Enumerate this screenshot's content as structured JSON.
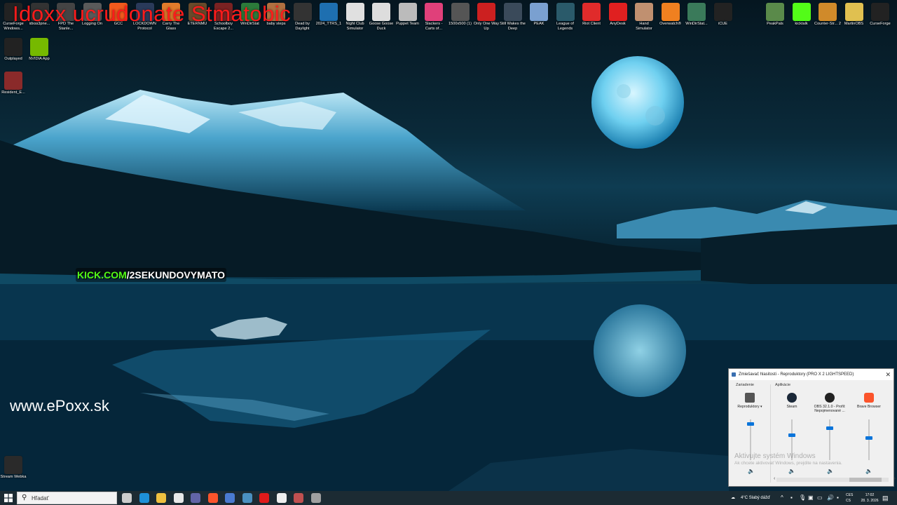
{
  "overlay": {
    "red_text": "Idoxx ucrudonate Stmatobic",
    "kick_part1": "KICK.COM",
    "kick_part2": "/2SEKUNDOVYMATO",
    "site_url": "www.ePoxx.sk"
  },
  "desktop_icons_top": [
    {
      "label": "CurseForge Windows...",
      "color": "#222222"
    },
    {
      "label": "idxss3pne...",
      "color": "#333333"
    },
    {
      "label": "FPD The Stanle...",
      "color": "#444444"
    },
    {
      "label": "Logging On",
      "color": "#5a5a5a"
    },
    {
      "label": "GCC",
      "color": "#f25a1d"
    },
    {
      "label": "LOCKDOWN Protocol",
      "color": "#2a3a5a"
    },
    {
      "label": "Carry The Glass",
      "color": "#e07b2b"
    },
    {
      "label": "ETERNMU",
      "color": "#6a4a2a"
    },
    {
      "label": "Schoolboy Escape 2...",
      "color": "#7a2222"
    },
    {
      "label": "WinDirStat",
      "color": "#2c7a3a"
    },
    {
      "label": "baby steps",
      "color": "#b07040"
    },
    {
      "label": "Dead by Daylight",
      "color": "#333333"
    },
    {
      "label": "2024_TTRS_1",
      "color": "#1e6fb0"
    },
    {
      "label": "Night Club Simulator",
      "color": "#e0e0e0"
    },
    {
      "label": "Goose Goose Duck",
      "color": "#dddddd"
    },
    {
      "label": "Puppet Team",
      "color": "#bbbbbb"
    },
    {
      "label": "Slackers - Carts of...",
      "color": "#e0407a"
    },
    {
      "label": "1500x500 (1)",
      "color": "#555555"
    },
    {
      "label": "Only One Way Up",
      "color": "#cc2020"
    },
    {
      "label": "Still Wakes the Deep",
      "color": "#3a4a5a"
    },
    {
      "label": "PEAK",
      "color": "#7aa0d0"
    },
    {
      "label": "League of Legends",
      "color": "#2a5a6a"
    },
    {
      "label": "Riot Client",
      "color": "#e02b2b"
    },
    {
      "label": "AnyDesk",
      "color": "#e02020"
    },
    {
      "label": "Hand Simulator",
      "color": "#c09070"
    },
    {
      "label": "Overwatch®",
      "color": "#f08020"
    },
    {
      "label": "WinDirStat...",
      "color": "#3a7a5a"
    },
    {
      "label": "iCUE",
      "color": "#222222"
    }
  ],
  "desktop_icons_right": [
    {
      "label": "PeakPals",
      "color": "#5a8a4a"
    },
    {
      "label": "kicktalk",
      "color": "#53fc18"
    },
    {
      "label": "Counter-Str... 2",
      "color": "#d08a2a"
    },
    {
      "label": "MartinOBS",
      "color": "#e0c050"
    },
    {
      "label": "CurseForge",
      "color": "#222222"
    }
  ],
  "desktop_icons_left": [
    {
      "label": "Outplayed",
      "color": "#222222"
    },
    {
      "label": "NVIDIA App",
      "color": "#76b900"
    },
    {
      "label": "Resident_E...",
      "color": "#8a2a2a"
    },
    {
      "label": "Stream Webka",
      "color": "#2a2a2a"
    }
  ],
  "mixer": {
    "title": "Zmiešavač hlasitosti - Reproduktory (PRO X 2 LIGHTSPEED)",
    "section_devices": "Zariadenie",
    "section_apps": "Aplikácie",
    "channels": [
      {
        "name": "Reproduktory ▾",
        "color": "#555555",
        "level": 0.92
      },
      {
        "name": "Steam",
        "color": "#1b2838",
        "level": 0.62
      },
      {
        "name": "OBS 32.1.0 - Profil: Nepojmenované ...",
        "color": "#222222",
        "level": 0.82
      },
      {
        "name": "Brave Browser",
        "color": "#fb542b",
        "level": 0.55
      }
    ],
    "watermark_title": "Aktivujte systém Windows",
    "watermark_sub": "Ak chcete aktivovať Windows, prejdite na nastavenia."
  },
  "taskbar": {
    "search_placeholder": "Hľadať",
    "apps": [
      {
        "name": "task-view-icon",
        "color": "#cccccc"
      },
      {
        "name": "edge-icon",
        "color": "#1e90d8"
      },
      {
        "name": "file-explorer-icon",
        "color": "#f0c040"
      },
      {
        "name": "store-icon",
        "color": "#e8e8e8"
      },
      {
        "name": "teams-icon",
        "color": "#6264a7"
      },
      {
        "name": "brave-icon",
        "color": "#fb542b"
      },
      {
        "name": "app-icon",
        "color": "#4a7ad0"
      },
      {
        "name": "steam-icon",
        "color": "#4a90c0"
      },
      {
        "name": "opera-icon",
        "color": "#e01a1a"
      },
      {
        "name": "obs-icon",
        "color": "#eeeeee"
      },
      {
        "name": "app2-icon",
        "color": "#c05050"
      },
      {
        "name": "app3-icon",
        "color": "#a0a0a0"
      }
    ],
    "weather": "4°C  Slabý dážď",
    "lang": "CES CS",
    "time": "17:02",
    "date": "28. 3. 2026"
  }
}
